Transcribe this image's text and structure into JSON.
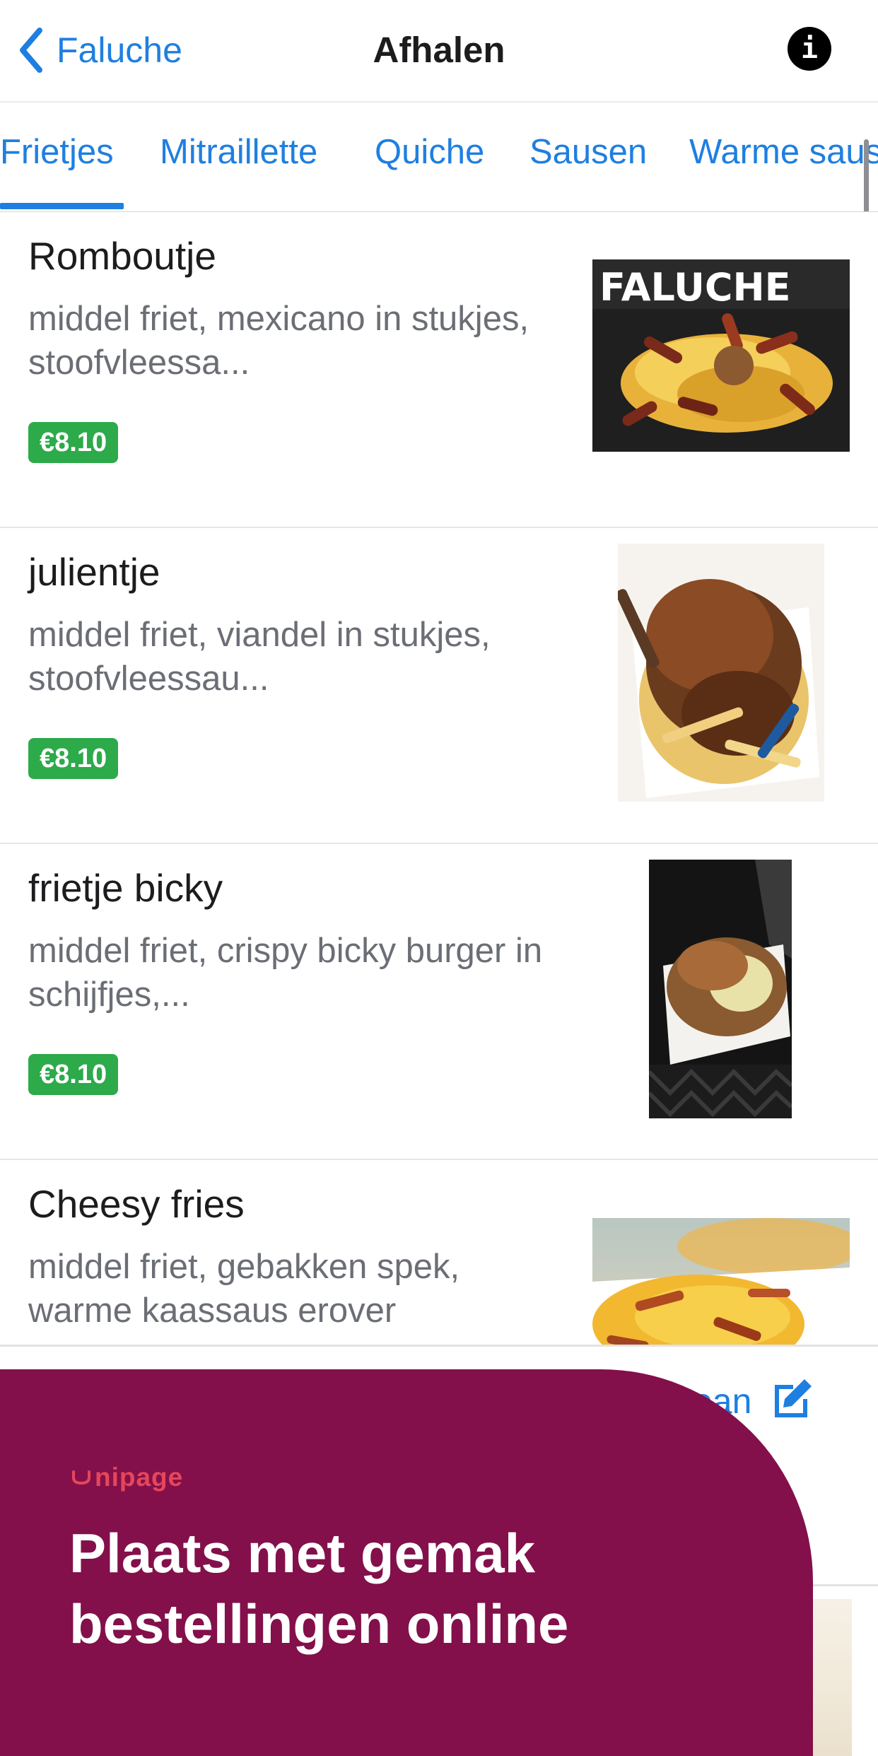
{
  "nav": {
    "back_label": "Faluche",
    "title": "Afhalen",
    "info_glyph": "i"
  },
  "tabs": [
    {
      "label": "Frietjes",
      "active": true
    },
    {
      "label": "Mitraillette",
      "active": false
    },
    {
      "label": "Quiche",
      "active": false
    },
    {
      "label": "Sausen",
      "active": false
    },
    {
      "label": "Warme sausen",
      "active": false
    }
  ],
  "items": [
    {
      "name": "Romboutje",
      "description": "middel friet, mexicano in stukjes, stoofvleessa...",
      "price": "€8.10",
      "image_text": "FALUCHE"
    },
    {
      "name": "julientje",
      "description": "middel friet, viandel in stukjes, stoofvleessau...",
      "price": "€8.10"
    },
    {
      "name": "frietje bicky",
      "description": "middel friet, crispy bicky burger in schijfjes,...",
      "price": "€8.10"
    },
    {
      "name": "Cheesy fries",
      "description": "middel friet, gebakken spek, warme kaassaus erover"
    }
  ],
  "cart": {
    "label_visible": "ean",
    "icon": "edit-icon"
  },
  "promo": {
    "logo_text": "nipage",
    "headline": "Plaats met gemak bestellingen online"
  },
  "colors": {
    "accent": "#1f7fe0",
    "price_badge": "#2daa4a",
    "promo_bg": "#83104a",
    "promo_logo": "#e6465a"
  }
}
